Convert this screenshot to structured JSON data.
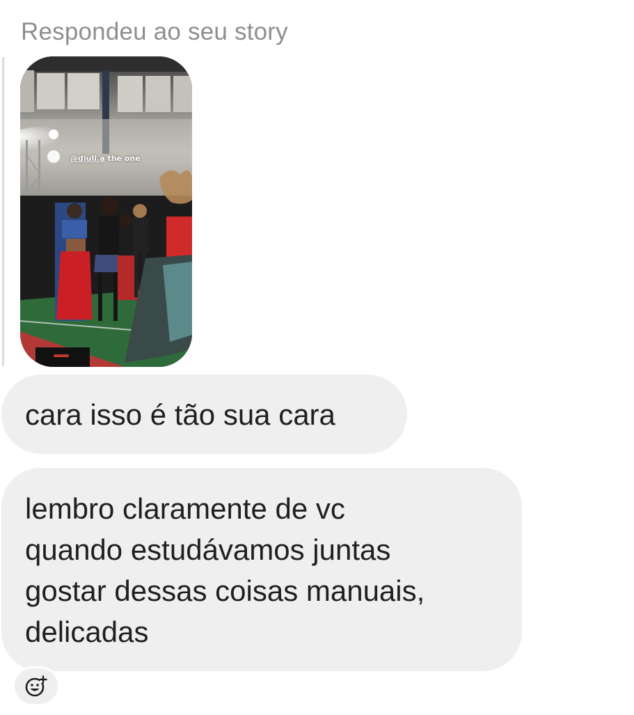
{
  "header": {
    "reply_label": "Respondeu ao seu story"
  },
  "story": {
    "mention_handle": "@diuli.a",
    "mention_text": " the one"
  },
  "messages": [
    {
      "text": "cara isso é tão sua cara"
    },
    {
      "lines": [
        "lembro claramente de vc",
        "quando estudávamos juntas",
        "gostar dessas coisas manuais,",
        "delicadas"
      ]
    }
  ],
  "reaction": {
    "icon": "add-reaction-icon"
  },
  "colors": {
    "bubble_bg": "#efefef",
    "label_gray": "#8e8e8e",
    "text": "#1f1f1f"
  }
}
